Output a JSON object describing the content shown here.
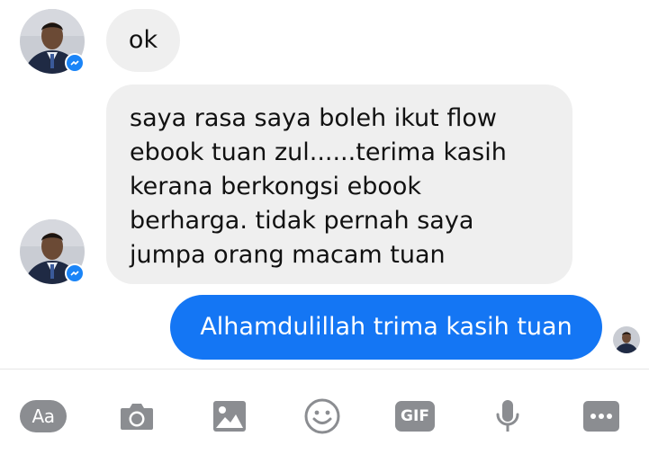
{
  "messages": [
    {
      "sender": "them",
      "text": "ok"
    },
    {
      "sender": "them",
      "lines": [
        "saya rasa saya boleh ikut flow",
        "ebook tuan zul......terima kasih",
        "kerana berkongsi ebook",
        "berharga. tidak pernah saya",
        "jumpa orang macam tuan"
      ]
    },
    {
      "sender": "me",
      "text": "Alhamdulillah trima kasih tuan"
    }
  ],
  "composer": {
    "text_button_label": "Aa",
    "tools": [
      "text-format-icon",
      "camera-icon",
      "image-icon",
      "emoji-icon",
      "gif-icon",
      "microphone-icon",
      "more-icon"
    ],
    "gif_label": "GIF"
  },
  "colors": {
    "incoming_bubble": "#efefef",
    "outgoing_bubble": "#1476f4",
    "messenger_badge": "#1a84f7",
    "toolbar_icon": "#8b8d91"
  }
}
